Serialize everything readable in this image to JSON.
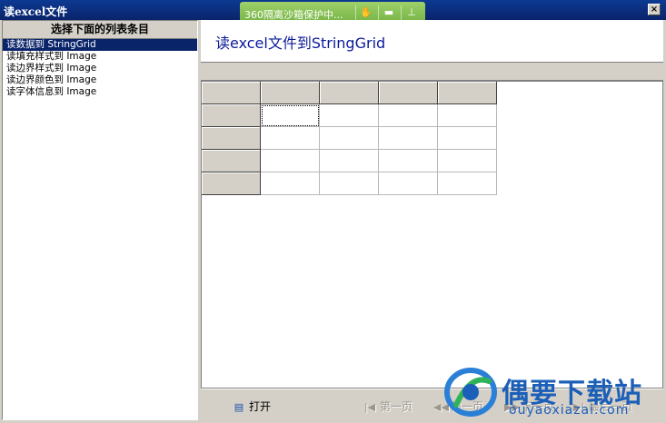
{
  "window": {
    "title": "读excel文件",
    "close_label": "×"
  },
  "sandbox": {
    "label": "360隔离沙箱保护中...",
    "icons": [
      "sandbox-hand-icon",
      "folder-icon",
      "pin-icon"
    ],
    "color": "#7ec04f"
  },
  "left_panel": {
    "header": "选择下面的列表条目",
    "items": [
      "读数据到 StringGrid",
      "读填充样式到 Image",
      "读边界样式到 Image",
      "读边界颜色到 Image",
      "读字体信息到 Image"
    ],
    "selected_index": 0
  },
  "main": {
    "title": "读excel文件到StringGrid",
    "title_color": "#0a1a9a"
  },
  "grid": {
    "columns": 5,
    "rows": 5,
    "fixed_columns": 1,
    "fixed_rows": 1,
    "focused_cell": [
      1,
      1
    ]
  },
  "toolbar": {
    "open_label": "打开",
    "first_label": "第一页",
    "prev_label": "前一页",
    "next_label": "下一页",
    "last_label": "最后一页"
  },
  "watermark": {
    "name": "偶要下载站",
    "url": "ouyaoxiazai.com",
    "color": "#1b5fb8"
  }
}
